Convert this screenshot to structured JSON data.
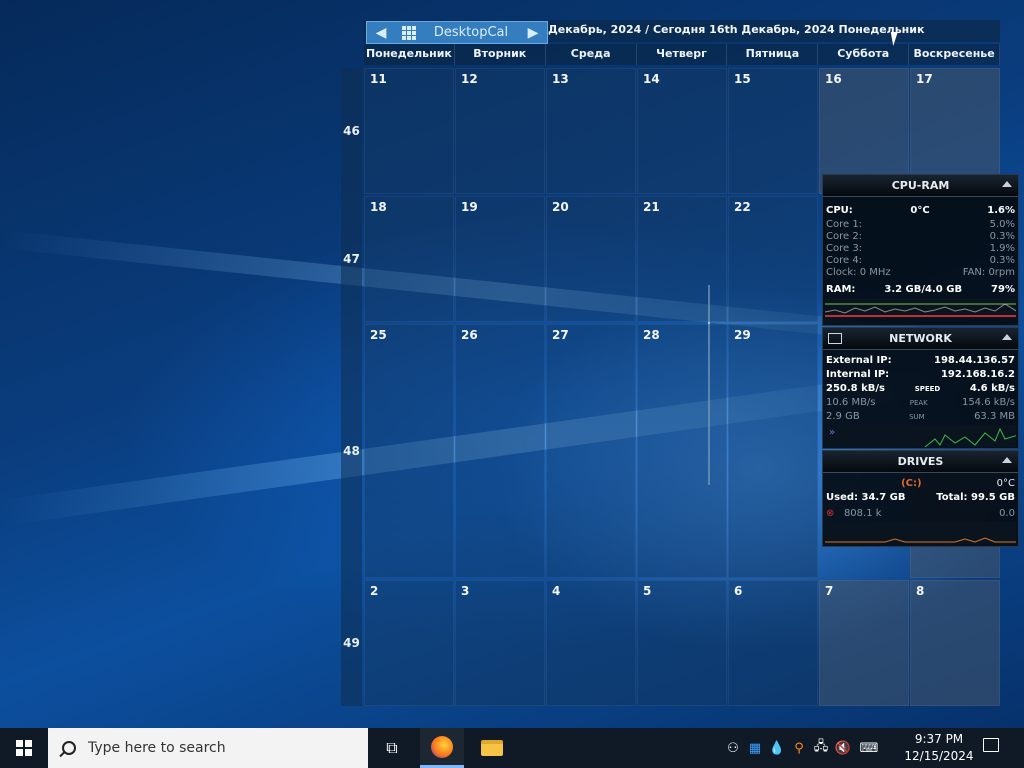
{
  "calendar": {
    "app_name": "DesktopCal",
    "title": "Декабрь, 2024 / Сегодня 16th Декабрь, 2024 Понедельник",
    "day_names": [
      "Понедельник",
      "Вторник",
      "Среда",
      "Четверг",
      "Пятница",
      "Суббота",
      "Воскресенье"
    ],
    "weeks": [
      {
        "num": "46",
        "days": [
          "11",
          "12",
          "13",
          "14",
          "15",
          "16",
          "17"
        ]
      },
      {
        "num": "47",
        "days": [
          "18",
          "19",
          "20",
          "21",
          "22",
          "",
          ""
        ]
      },
      {
        "num": "48",
        "days": [
          "25",
          "26",
          "27",
          "28",
          "29",
          "",
          ""
        ]
      },
      {
        "num": "49",
        "days": [
          "2",
          "3",
          "4",
          "5",
          "6",
          "7",
          "8"
        ]
      }
    ]
  },
  "cpu_ram": {
    "title": "CPU-RAM",
    "cpu_label": "CPU:",
    "cpu_temp": "0°C",
    "cpu_load": "1.6%",
    "cores": [
      {
        "label": "Core 1:",
        "value": "5.0%"
      },
      {
        "label": "Core 2:",
        "value": "0.3%"
      },
      {
        "label": "Core 3:",
        "value": "1.9%"
      },
      {
        "label": "Core 4:",
        "value": "0.3%"
      }
    ],
    "clock": "Clock: 0 MHz",
    "fan": "FAN: 0rpm",
    "ram_label": "RAM:",
    "ram_value": "3.2 GB/4.0 GB",
    "ram_pct": "79%"
  },
  "network": {
    "title": "NETWORK",
    "ext_label": "External IP:",
    "ext_ip": "198.44.136.57",
    "int_label": "Internal IP:",
    "int_ip": "192.168.16.2",
    "speed_down": "250.8 kB/s",
    "speed_label": "SPEED",
    "speed_up": "4.6 kB/s",
    "peak_down": "10.6 MB/s",
    "peak_label": "PEAK",
    "peak_up": "154.6 kB/s",
    "sum_down": "2.9 GB",
    "sum_label": "SUM",
    "sum_up": "63.3 MB"
  },
  "drives": {
    "title": "DRIVES",
    "drive": "(C:)",
    "temp": "0°C",
    "used": "Used: 34.7 GB",
    "total": "Total: 99.5 GB",
    "read": "808.1 k",
    "write": "0.0"
  },
  "taskbar": {
    "search_placeholder": "Type here to search",
    "time": "9:37 PM",
    "date": "12/15/2024"
  }
}
